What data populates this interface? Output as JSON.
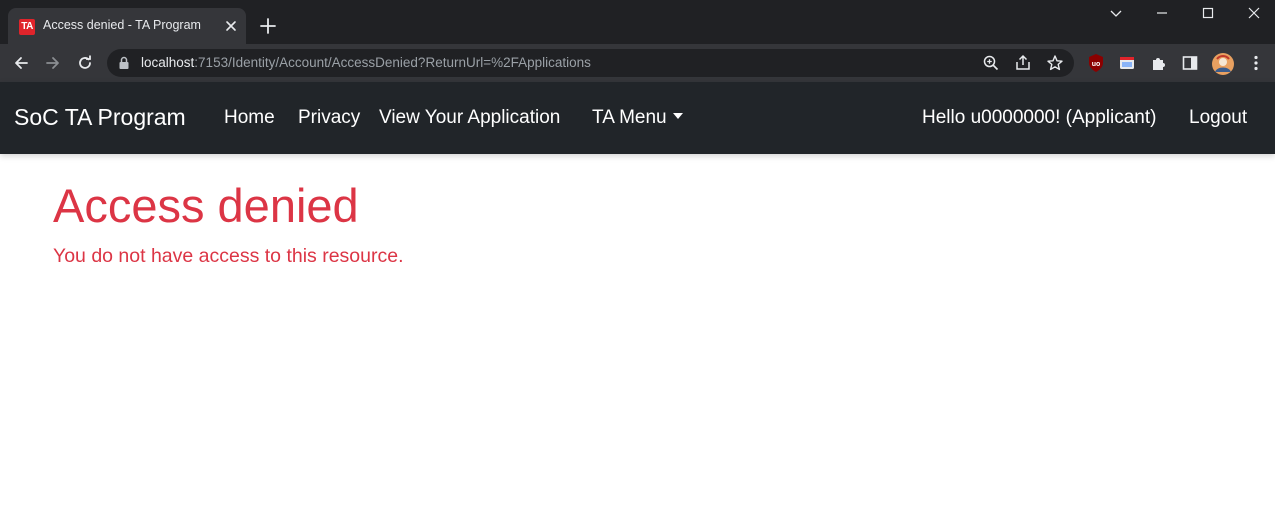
{
  "browser": {
    "tab_title": "Access denied - TA Program",
    "favicon_text": "TA",
    "url_host": "localhost",
    "url_rest": ":7153/Identity/Account/AccessDenied?ReturnUrl=%2FApplications",
    "accent_color": "#e0242b"
  },
  "navbar": {
    "brand": "SoC TA Program",
    "links": [
      "Home",
      "Privacy",
      "View Your Application",
      "TA Menu"
    ],
    "greeting": "Hello u0000000! (Applicant)",
    "logout": "Logout",
    "background_color": "#212529"
  },
  "main": {
    "title": "Access denied",
    "message": "You do not have access to this resource.",
    "text_color": "#dc3545"
  }
}
